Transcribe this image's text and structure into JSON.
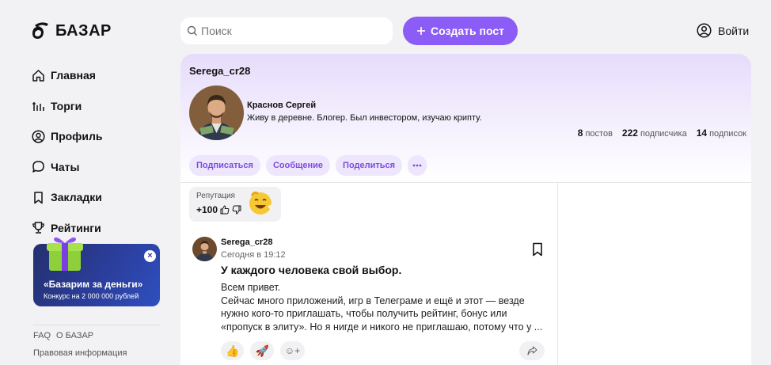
{
  "header": {
    "logo": "БАЗАР",
    "search_placeholder": "Поиск",
    "create_label": "Создать пост",
    "login_label": "Войти"
  },
  "sidebar": {
    "items": [
      {
        "label": "Главная",
        "icon": "home-icon"
      },
      {
        "label": "Торги",
        "icon": "trades-icon"
      },
      {
        "label": "Профиль",
        "icon": "profile-icon"
      },
      {
        "label": "Чаты",
        "icon": "chat-icon"
      },
      {
        "label": "Закладки",
        "icon": "bookmark-icon"
      },
      {
        "label": "Рейтинги",
        "icon": "trophy-icon"
      }
    ],
    "promo": {
      "title": "«Базарим за деньги»",
      "subtitle": "Конкурс на 2 000 000 рублей",
      "close": "×"
    },
    "footer_links": [
      "FAQ",
      "О БАЗАР"
    ],
    "legal": "Правовая информация"
  },
  "profile": {
    "username": "Serega_cr28",
    "full_name": "Краснов  Сергей",
    "bio": "Живу в деревне. Блогер. Был инвестором, изучаю крипту.",
    "stats": [
      {
        "value": "8",
        "label": "постов"
      },
      {
        "value": "222",
        "label": "подписчика"
      },
      {
        "value": "14",
        "label": "подписок"
      }
    ],
    "actions": [
      "Подписаться",
      "Сообщение",
      "Поделиться"
    ],
    "more": "•••",
    "reputation": {
      "label": "Репутация",
      "value": "+100"
    }
  },
  "post": {
    "author": "Serega_cr28",
    "time": "Сегодня в 19:12",
    "title": "У каждого человека свой выбор.",
    "body": "Всем привет.\nСейчас много приложений, игр в Телеграме и ещё и этот — везде нужно кого-то приглашать, чтобы получить рейтинг, бонус или «пропуск в элиту». Но я нигде и никого не приглашаю, потому что у ...",
    "reactions": [
      "👍",
      "🚀",
      "☺+"
    ]
  },
  "colors": {
    "accent": "#8b5cf6",
    "pill_bg": "#ede6fd",
    "pill_text": "#7c4ddf"
  }
}
